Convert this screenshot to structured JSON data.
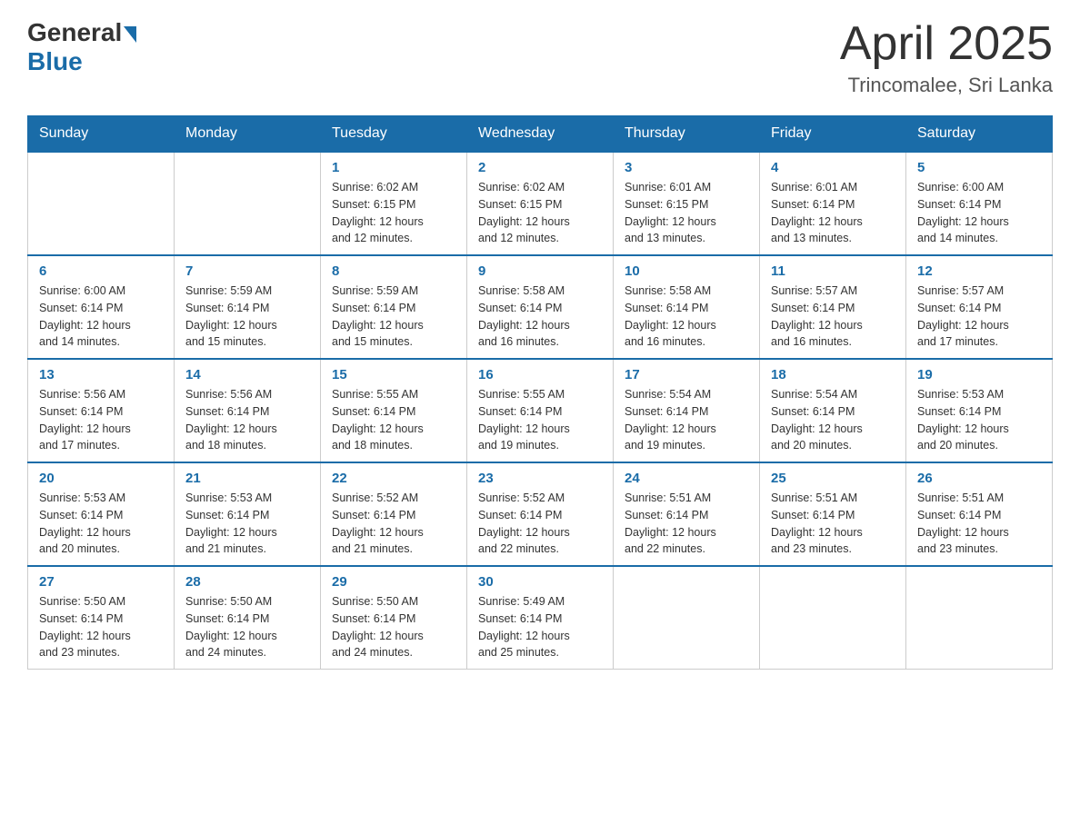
{
  "header": {
    "logo_general": "General",
    "logo_blue": "Blue",
    "month": "April 2025",
    "location": "Trincomalee, Sri Lanka"
  },
  "days_of_week": [
    "Sunday",
    "Monday",
    "Tuesday",
    "Wednesday",
    "Thursday",
    "Friday",
    "Saturday"
  ],
  "weeks": [
    [
      {
        "day": "",
        "info": ""
      },
      {
        "day": "",
        "info": ""
      },
      {
        "day": "1",
        "info": "Sunrise: 6:02 AM\nSunset: 6:15 PM\nDaylight: 12 hours\nand 12 minutes."
      },
      {
        "day": "2",
        "info": "Sunrise: 6:02 AM\nSunset: 6:15 PM\nDaylight: 12 hours\nand 12 minutes."
      },
      {
        "day": "3",
        "info": "Sunrise: 6:01 AM\nSunset: 6:15 PM\nDaylight: 12 hours\nand 13 minutes."
      },
      {
        "day": "4",
        "info": "Sunrise: 6:01 AM\nSunset: 6:14 PM\nDaylight: 12 hours\nand 13 minutes."
      },
      {
        "day": "5",
        "info": "Sunrise: 6:00 AM\nSunset: 6:14 PM\nDaylight: 12 hours\nand 14 minutes."
      }
    ],
    [
      {
        "day": "6",
        "info": "Sunrise: 6:00 AM\nSunset: 6:14 PM\nDaylight: 12 hours\nand 14 minutes."
      },
      {
        "day": "7",
        "info": "Sunrise: 5:59 AM\nSunset: 6:14 PM\nDaylight: 12 hours\nand 15 minutes."
      },
      {
        "day": "8",
        "info": "Sunrise: 5:59 AM\nSunset: 6:14 PM\nDaylight: 12 hours\nand 15 minutes."
      },
      {
        "day": "9",
        "info": "Sunrise: 5:58 AM\nSunset: 6:14 PM\nDaylight: 12 hours\nand 16 minutes."
      },
      {
        "day": "10",
        "info": "Sunrise: 5:58 AM\nSunset: 6:14 PM\nDaylight: 12 hours\nand 16 minutes."
      },
      {
        "day": "11",
        "info": "Sunrise: 5:57 AM\nSunset: 6:14 PM\nDaylight: 12 hours\nand 16 minutes."
      },
      {
        "day": "12",
        "info": "Sunrise: 5:57 AM\nSunset: 6:14 PM\nDaylight: 12 hours\nand 17 minutes."
      }
    ],
    [
      {
        "day": "13",
        "info": "Sunrise: 5:56 AM\nSunset: 6:14 PM\nDaylight: 12 hours\nand 17 minutes."
      },
      {
        "day": "14",
        "info": "Sunrise: 5:56 AM\nSunset: 6:14 PM\nDaylight: 12 hours\nand 18 minutes."
      },
      {
        "day": "15",
        "info": "Sunrise: 5:55 AM\nSunset: 6:14 PM\nDaylight: 12 hours\nand 18 minutes."
      },
      {
        "day": "16",
        "info": "Sunrise: 5:55 AM\nSunset: 6:14 PM\nDaylight: 12 hours\nand 19 minutes."
      },
      {
        "day": "17",
        "info": "Sunrise: 5:54 AM\nSunset: 6:14 PM\nDaylight: 12 hours\nand 19 minutes."
      },
      {
        "day": "18",
        "info": "Sunrise: 5:54 AM\nSunset: 6:14 PM\nDaylight: 12 hours\nand 20 minutes."
      },
      {
        "day": "19",
        "info": "Sunrise: 5:53 AM\nSunset: 6:14 PM\nDaylight: 12 hours\nand 20 minutes."
      }
    ],
    [
      {
        "day": "20",
        "info": "Sunrise: 5:53 AM\nSunset: 6:14 PM\nDaylight: 12 hours\nand 20 minutes."
      },
      {
        "day": "21",
        "info": "Sunrise: 5:53 AM\nSunset: 6:14 PM\nDaylight: 12 hours\nand 21 minutes."
      },
      {
        "day": "22",
        "info": "Sunrise: 5:52 AM\nSunset: 6:14 PM\nDaylight: 12 hours\nand 21 minutes."
      },
      {
        "day": "23",
        "info": "Sunrise: 5:52 AM\nSunset: 6:14 PM\nDaylight: 12 hours\nand 22 minutes."
      },
      {
        "day": "24",
        "info": "Sunrise: 5:51 AM\nSunset: 6:14 PM\nDaylight: 12 hours\nand 22 minutes."
      },
      {
        "day": "25",
        "info": "Sunrise: 5:51 AM\nSunset: 6:14 PM\nDaylight: 12 hours\nand 23 minutes."
      },
      {
        "day": "26",
        "info": "Sunrise: 5:51 AM\nSunset: 6:14 PM\nDaylight: 12 hours\nand 23 minutes."
      }
    ],
    [
      {
        "day": "27",
        "info": "Sunrise: 5:50 AM\nSunset: 6:14 PM\nDaylight: 12 hours\nand 23 minutes."
      },
      {
        "day": "28",
        "info": "Sunrise: 5:50 AM\nSunset: 6:14 PM\nDaylight: 12 hours\nand 24 minutes."
      },
      {
        "day": "29",
        "info": "Sunrise: 5:50 AM\nSunset: 6:14 PM\nDaylight: 12 hours\nand 24 minutes."
      },
      {
        "day": "30",
        "info": "Sunrise: 5:49 AM\nSunset: 6:14 PM\nDaylight: 12 hours\nand 25 minutes."
      },
      {
        "day": "",
        "info": ""
      },
      {
        "day": "",
        "info": ""
      },
      {
        "day": "",
        "info": ""
      }
    ]
  ]
}
